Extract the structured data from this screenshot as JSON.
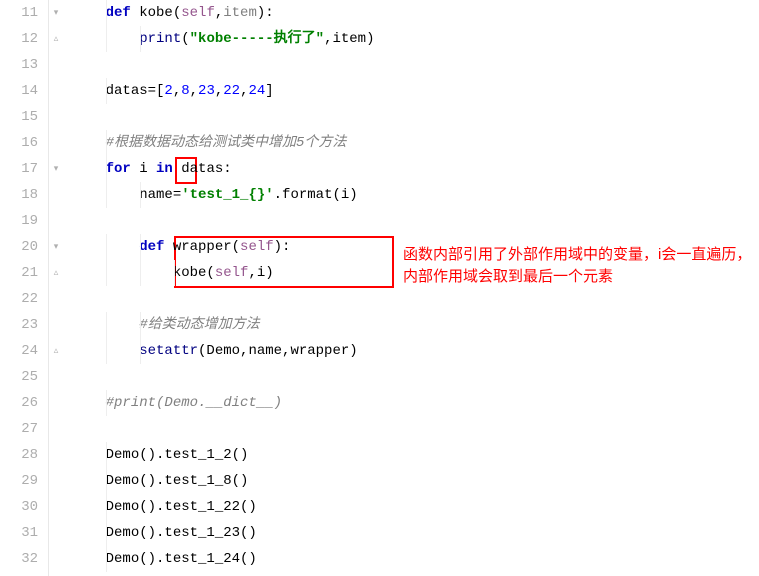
{
  "colors": {
    "highlight": "#ff0000",
    "keyword": "#0000c0",
    "string": "#008000",
    "number": "#0000ff",
    "comment": "#808080",
    "self": "#94558d"
  },
  "annotation": "函数内部引用了外部作用域中的变量，i会一直遍历，内部作用域会取到最后一个元素",
  "lines": [
    {
      "num": "11",
      "segs": [
        {
          "indent": 1
        },
        {
          "cls": "kw",
          "t": "def "
        },
        {
          "cls": "func",
          "t": "kobe"
        },
        {
          "cls": "plain",
          "t": "("
        },
        {
          "cls": "self",
          "t": "self"
        },
        {
          "cls": "plain",
          "t": ","
        },
        {
          "cls": "param",
          "t": "item"
        },
        {
          "cls": "plain",
          "t": "):"
        }
      ]
    },
    {
      "num": "12",
      "segs": [
        {
          "indent": 2
        },
        {
          "cls": "builtin",
          "t": "print"
        },
        {
          "cls": "plain",
          "t": "("
        },
        {
          "cls": "str",
          "t": "\"kobe-----执行了\""
        },
        {
          "cls": "plain",
          "t": ","
        },
        {
          "cls": "plain",
          "t": "item)"
        }
      ]
    },
    {
      "num": "13",
      "segs": []
    },
    {
      "num": "14",
      "segs": [
        {
          "indent": 1
        },
        {
          "cls": "plain",
          "t": "datas=["
        },
        {
          "cls": "num",
          "t": "2"
        },
        {
          "cls": "plain",
          "t": ","
        },
        {
          "cls": "num",
          "t": "8"
        },
        {
          "cls": "plain",
          "t": ","
        },
        {
          "cls": "num",
          "t": "23"
        },
        {
          "cls": "plain",
          "t": ","
        },
        {
          "cls": "num",
          "t": "22"
        },
        {
          "cls": "plain",
          "t": ","
        },
        {
          "cls": "num",
          "t": "24"
        },
        {
          "cls": "plain",
          "t": "]"
        }
      ]
    },
    {
      "num": "15",
      "segs": []
    },
    {
      "num": "16",
      "segs": [
        {
          "indent": 1
        },
        {
          "cls": "comment",
          "t": "#根据数据动态给测试类中增加5个方法"
        }
      ]
    },
    {
      "num": "17",
      "segs": [
        {
          "indent": 1
        },
        {
          "cls": "kw",
          "t": "for "
        },
        {
          "cls": "plain",
          "t": "i "
        },
        {
          "cls": "kw",
          "t": "in "
        },
        {
          "cls": "plain",
          "t": "datas:"
        }
      ]
    },
    {
      "num": "18",
      "segs": [
        {
          "indent": 2
        },
        {
          "cls": "plain",
          "t": "name="
        },
        {
          "cls": "str",
          "t": "'test_1_{}'"
        },
        {
          "cls": "plain",
          "t": ".format(i)"
        }
      ]
    },
    {
      "num": "19",
      "segs": []
    },
    {
      "num": "20",
      "segs": [
        {
          "indent": 2
        },
        {
          "cls": "kw",
          "t": "def "
        },
        {
          "cls": "func",
          "t": "wrapper"
        },
        {
          "cls": "plain",
          "t": "("
        },
        {
          "cls": "self",
          "t": "self"
        },
        {
          "cls": "plain",
          "t": "):"
        }
      ]
    },
    {
      "num": "21",
      "segs": [
        {
          "indent": 3
        },
        {
          "cls": "plain",
          "t": "kobe("
        },
        {
          "cls": "self",
          "t": "self"
        },
        {
          "cls": "plain",
          "t": ",i)"
        }
      ]
    },
    {
      "num": "22",
      "segs": []
    },
    {
      "num": "23",
      "segs": [
        {
          "indent": 2
        },
        {
          "cls": "comment",
          "t": "#给类动态增加方法"
        }
      ]
    },
    {
      "num": "24",
      "segs": [
        {
          "indent": 2
        },
        {
          "cls": "builtin",
          "t": "setattr"
        },
        {
          "cls": "plain",
          "t": "(Demo,name,wrapper)"
        }
      ]
    },
    {
      "num": "25",
      "segs": []
    },
    {
      "num": "26",
      "segs": [
        {
          "indent": 1
        },
        {
          "cls": "comment",
          "t": "#print(Demo.__dict__)"
        }
      ]
    },
    {
      "num": "27",
      "segs": []
    },
    {
      "num": "28",
      "segs": [
        {
          "indent": 1
        },
        {
          "cls": "plain",
          "t": "Demo().test_1_2()"
        }
      ]
    },
    {
      "num": "29",
      "segs": [
        {
          "indent": 1
        },
        {
          "cls": "plain",
          "t": "Demo().test_1_8()"
        }
      ]
    },
    {
      "num": "30",
      "segs": [
        {
          "indent": 1
        },
        {
          "cls": "plain",
          "t": "Demo().test_1_22()"
        }
      ]
    },
    {
      "num": "31",
      "segs": [
        {
          "indent": 1
        },
        {
          "cls": "plain",
          "t": "Demo().test_1_23()"
        }
      ]
    },
    {
      "num": "32",
      "segs": [
        {
          "indent": 1
        },
        {
          "cls": "plain",
          "t": "Demo().test_1_24()"
        }
      ]
    }
  ],
  "fold_markers": [
    {
      "line": 0,
      "sym": "▾"
    },
    {
      "line": 1,
      "sym": "▵"
    },
    {
      "line": 6,
      "sym": "▾"
    },
    {
      "line": 9,
      "sym": "▾"
    },
    {
      "line": 10,
      "sym": "▵"
    },
    {
      "line": 13,
      "sym": "▵"
    }
  ]
}
